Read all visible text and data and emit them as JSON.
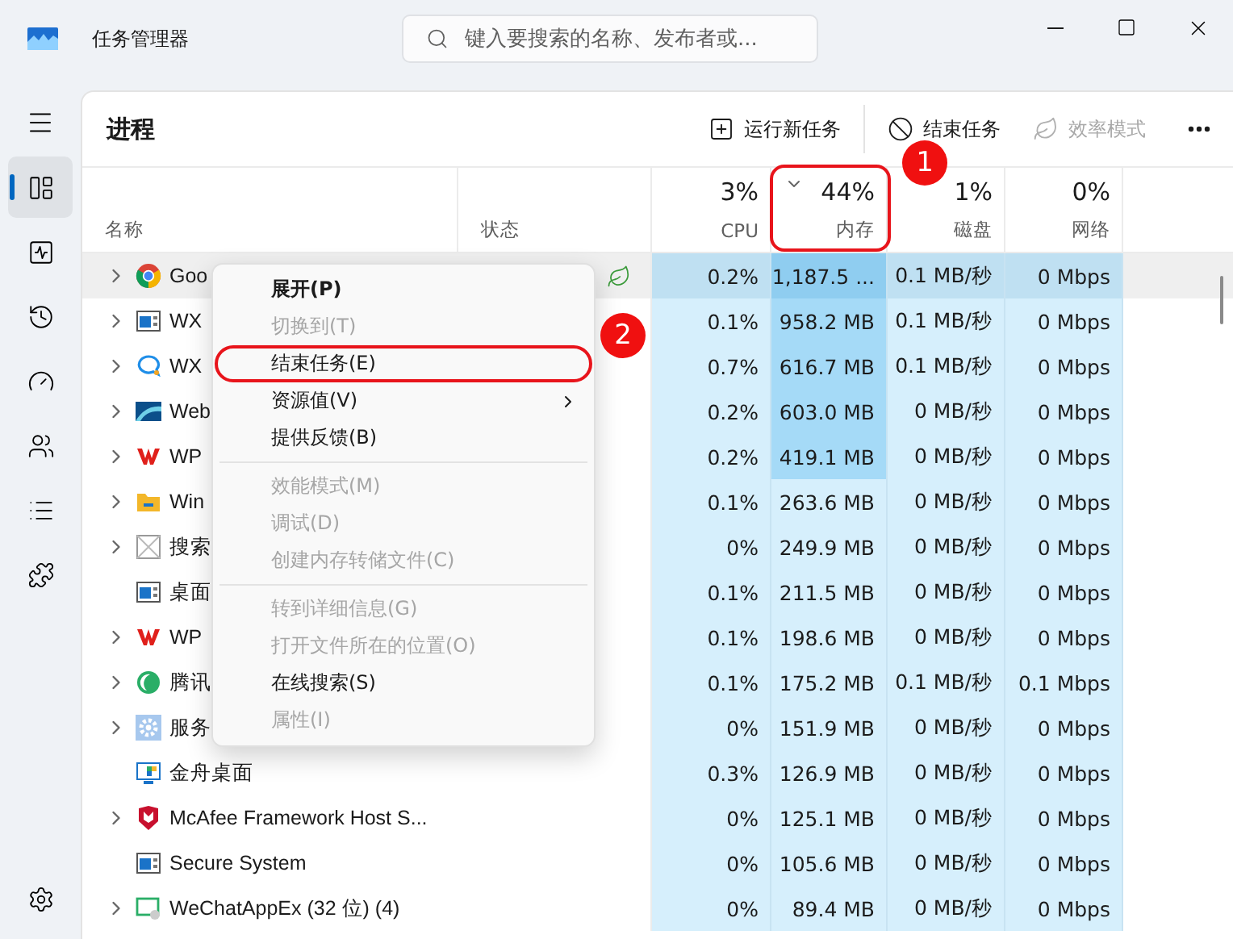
{
  "window": {
    "title": "任务管理器"
  },
  "search": {
    "placeholder": "键入要搜索的名称、发布者或..."
  },
  "nav": {
    "items": [
      {
        "selected": true
      },
      {
        "selected": false
      },
      {
        "selected": false
      },
      {
        "selected": false
      },
      {
        "selected": false
      },
      {
        "selected": false
      },
      {
        "selected": false
      }
    ]
  },
  "page": {
    "title": "进程"
  },
  "toolbar": [
    {
      "label": "运行新任务",
      "disabled": false
    },
    {
      "label": "结束任务",
      "disabled": false
    },
    {
      "label": "效率模式",
      "disabled": true
    }
  ],
  "columns": [
    {
      "kind": "text",
      "label": "名称"
    },
    {
      "kind": "text",
      "label": "状态"
    },
    {
      "kind": "metric",
      "percent": "3%",
      "label": "CPU",
      "sorted": false
    },
    {
      "kind": "metric",
      "percent": "44%",
      "label": "内存",
      "sorted": true
    },
    {
      "kind": "metric",
      "percent": "1%",
      "label": "磁盘",
      "sorted": false
    },
    {
      "kind": "metric",
      "percent": "0%",
      "label": "网络",
      "sorted": false
    }
  ],
  "rows": [
    {
      "name": "Goo",
      "expandable": true,
      "selected": true,
      "efficiency": true,
      "cpu": "0.2%",
      "memory": "1,187.5 ...",
      "memory_high": true,
      "disk": "0.1 MB/秒",
      "network": "0 Mbps"
    },
    {
      "name": "WX",
      "expandable": true,
      "selected": false,
      "efficiency": false,
      "cpu": "0.1%",
      "memory": "958.2 MB",
      "memory_high": true,
      "disk": "0.1 MB/秒",
      "network": "0 Mbps"
    },
    {
      "name": "WX",
      "expandable": true,
      "selected": false,
      "efficiency": false,
      "cpu": "0.7%",
      "memory": "616.7 MB",
      "memory_high": true,
      "disk": "0.1 MB/秒",
      "network": "0 Mbps"
    },
    {
      "name": "Web",
      "expandable": true,
      "selected": false,
      "efficiency": false,
      "cpu": "0.2%",
      "memory": "603.0 MB",
      "memory_high": true,
      "disk": "0 MB/秒",
      "network": "0 Mbps"
    },
    {
      "name": "WP",
      "expandable": true,
      "selected": false,
      "efficiency": false,
      "cpu": "0.2%",
      "memory": "419.1 MB",
      "memory_high": true,
      "disk": "0 MB/秒",
      "network": "0 Mbps"
    },
    {
      "name": "Win",
      "expandable": true,
      "selected": false,
      "efficiency": false,
      "cpu": "0.1%",
      "memory": "263.6 MB",
      "memory_high": false,
      "disk": "0 MB/秒",
      "network": "0 Mbps"
    },
    {
      "name": "搜索",
      "expandable": true,
      "selected": false,
      "efficiency": false,
      "cpu": "0%",
      "memory": "249.9 MB",
      "memory_high": false,
      "disk": "0 MB/秒",
      "network": "0 Mbps"
    },
    {
      "name": "桌面",
      "expandable": false,
      "selected": false,
      "efficiency": false,
      "cpu": "0.1%",
      "memory": "211.5 MB",
      "memory_high": false,
      "disk": "0 MB/秒",
      "network": "0 Mbps"
    },
    {
      "name": "WP",
      "expandable": true,
      "selected": false,
      "efficiency": false,
      "cpu": "0.1%",
      "memory": "198.6 MB",
      "memory_high": false,
      "disk": "0 MB/秒",
      "network": "0 Mbps"
    },
    {
      "name": "腾讯",
      "expandable": true,
      "selected": false,
      "efficiency": false,
      "cpu": "0.1%",
      "memory": "175.2 MB",
      "memory_high": false,
      "disk": "0.1 MB/秒",
      "network": "0.1 Mbps"
    },
    {
      "name": "服务",
      "expandable": true,
      "selected": false,
      "efficiency": false,
      "cpu": "0%",
      "memory": "151.9 MB",
      "memory_high": false,
      "disk": "0 MB/秒",
      "network": "0 Mbps"
    },
    {
      "name": "金舟桌面",
      "expandable": false,
      "selected": false,
      "efficiency": false,
      "cpu": "0.3%",
      "memory": "126.9 MB",
      "memory_high": false,
      "disk": "0 MB/秒",
      "network": "0 Mbps"
    },
    {
      "name": "McAfee Framework Host S...",
      "expandable": true,
      "selected": false,
      "efficiency": false,
      "cpu": "0%",
      "memory": "125.1 MB",
      "memory_high": false,
      "disk": "0 MB/秒",
      "network": "0 Mbps"
    },
    {
      "name": "Secure System",
      "expandable": false,
      "selected": false,
      "efficiency": false,
      "cpu": "0%",
      "memory": "105.6 MB",
      "memory_high": false,
      "disk": "0 MB/秒",
      "network": "0 Mbps"
    },
    {
      "name": "WeChatAppEx (32 位) (4)",
      "expandable": true,
      "selected": false,
      "efficiency": false,
      "cpu": "0%",
      "memory": "89.4 MB",
      "memory_high": false,
      "disk": "0 MB/秒",
      "network": "0 Mbps"
    }
  ],
  "context_menu": [
    {
      "kind": "item",
      "label": "展开(P)",
      "default": true,
      "disabled": false,
      "submenu": false,
      "highlighted": false
    },
    {
      "kind": "item",
      "label": "切换到(T)",
      "default": false,
      "disabled": true,
      "submenu": false,
      "highlighted": false
    },
    {
      "kind": "item",
      "label": "结束任务(E)",
      "default": false,
      "disabled": false,
      "submenu": false,
      "highlighted": true
    },
    {
      "kind": "item",
      "label": "资源值(V)",
      "default": false,
      "disabled": false,
      "submenu": true,
      "highlighted": false
    },
    {
      "kind": "item",
      "label": "提供反馈(B)",
      "default": false,
      "disabled": false,
      "submenu": false,
      "highlighted": false
    },
    {
      "kind": "separator"
    },
    {
      "kind": "item",
      "label": "效能模式(M)",
      "default": false,
      "disabled": true,
      "submenu": false,
      "highlighted": false
    },
    {
      "kind": "item",
      "label": "调试(D)",
      "default": false,
      "disabled": true,
      "submenu": false,
      "highlighted": false
    },
    {
      "kind": "item",
      "label": "创建内存转储文件(C)",
      "default": false,
      "disabled": true,
      "submenu": false,
      "highlighted": false
    },
    {
      "kind": "separator"
    },
    {
      "kind": "item",
      "label": "转到详细信息(G)",
      "default": false,
      "disabled": true,
      "submenu": false,
      "highlighted": false
    },
    {
      "kind": "item",
      "label": "打开文件所在的位置(O)",
      "default": false,
      "disabled": true,
      "submenu": false,
      "highlighted": false
    },
    {
      "kind": "item",
      "label": "在线搜索(S)",
      "default": false,
      "disabled": false,
      "submenu": false,
      "highlighted": false
    },
    {
      "kind": "item",
      "label": "属性(I)",
      "default": false,
      "disabled": true,
      "submenu": false,
      "highlighted": false
    }
  ],
  "annotations": [
    {
      "label": "1"
    },
    {
      "label": "2"
    }
  ]
}
